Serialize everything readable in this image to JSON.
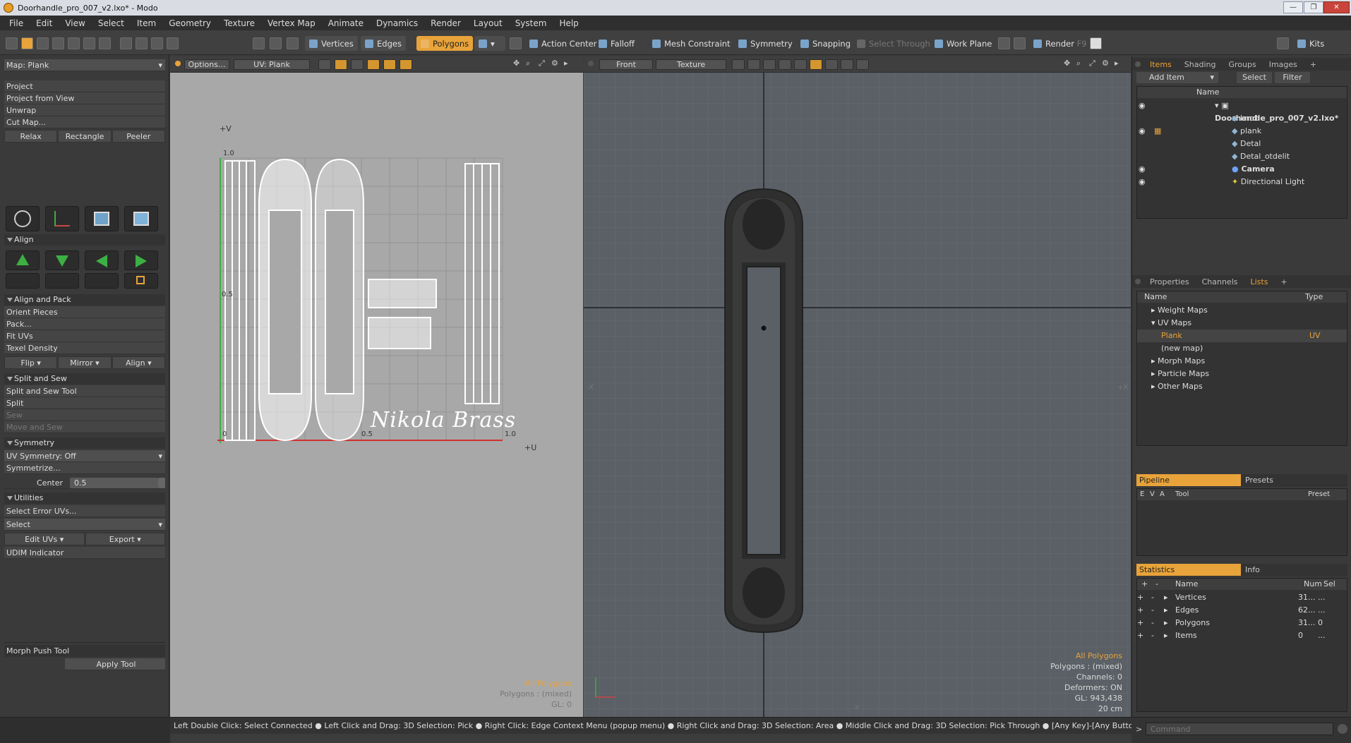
{
  "window": {
    "title": "Doorhandle_pro_007_v2.lxo* - Modo",
    "min": "—",
    "max": "❐",
    "close": "✕"
  },
  "menu": [
    "File",
    "Edit",
    "View",
    "Select",
    "Item",
    "Geometry",
    "Texture",
    "Vertex Map",
    "Animate",
    "Dynamics",
    "Render",
    "Layout",
    "System",
    "Help"
  ],
  "toolbar": {
    "vertices": "Vertices",
    "edges": "Edges",
    "polygons": "Polygons",
    "action_center": "Action Center",
    "falloff": "Falloff",
    "mesh_constraint": "Mesh Constraint",
    "symmetry": "Symmetry",
    "snapping": "Snapping",
    "select_through": "Select Through",
    "work_plane": "Work Plane",
    "render": "Render",
    "render_key": "F9",
    "kits": "Kits"
  },
  "left_panel": {
    "map_select": "Map: Plank",
    "project_items": [
      "Project",
      "Project from View",
      "Unwrap",
      "Cut Map..."
    ],
    "relax_buttons": [
      "Relax",
      "Rectangle",
      "Peeler"
    ],
    "align_head": "Align",
    "align_pack_head": "Align and Pack",
    "align_pack_items": [
      "Orient Pieces",
      "Pack...",
      "Fit UVs",
      "Texel Density"
    ],
    "fmalign": [
      "Flip",
      "Mirror",
      "Align"
    ],
    "split_sew_head": "Split and Sew",
    "split_sew_items": [
      "Split and Sew Tool",
      "Split",
      "Sew",
      "Move and Sew"
    ],
    "symmetry_head": "Symmetry",
    "uv_symmetry": "UV Symmetry: Off",
    "symmetrize": "Symmetrize...",
    "center_label": "Center",
    "center_value": "0.5",
    "utilities_head": "Utilities",
    "select_error": "Select Error UVs...",
    "select": "Select",
    "edit_uvs": "Edit UVs",
    "export": "Export",
    "udim": "UDIM Indicator",
    "morph_push": "Morph Push Tool",
    "apply_tool": "Apply Tool"
  },
  "uv_view": {
    "options": "Options...",
    "uv_label": "UV: Plank",
    "axis_v": "+V",
    "axis_u": "+U",
    "tick_top": "1.0",
    "tick_mid_v": "0.5",
    "tick_origin": "0",
    "tick_mid_u": "0.5",
    "tick_right": "1.0",
    "watermark": "Nikola Brass",
    "info_all": "All Polygons",
    "info_poly": "Polygons : (mixed)",
    "info_gl": "GL: 0"
  },
  "view_3d": {
    "mode": "Front",
    "shading": "Texture",
    "info_all": "All Polygons",
    "info_poly": "Polygons : (mixed)",
    "info_channels": "Channels: 0",
    "info_deformers": "Deformers: ON",
    "info_gl": "GL: 943,438",
    "info_scale": "20 cm",
    "axis_x_left": "-X",
    "axis_x_right": "+X",
    "axis_y": "-Y"
  },
  "items_panel": {
    "tabs": [
      "Items",
      "Shading",
      "Groups",
      "Images"
    ],
    "add_item": "Add Item",
    "select": "Select",
    "filter": "Filter",
    "col_name": "Name",
    "tree": [
      {
        "name": "Doorhandle_pro_007_v2.lxo*",
        "level": 0,
        "bold": true
      },
      {
        "name": "knob",
        "level": 1,
        "bold": false
      },
      {
        "name": "plank",
        "level": 1,
        "bold": false
      },
      {
        "name": "Detal",
        "level": 1,
        "bold": false
      },
      {
        "name": "Detal_otdelit",
        "level": 1,
        "bold": false
      },
      {
        "name": "Camera",
        "level": 1,
        "bold": true
      },
      {
        "name": "Directional Light",
        "level": 1,
        "bold": false
      }
    ]
  },
  "lists_panel": {
    "tabs": [
      "Properties",
      "Channels",
      "Lists"
    ],
    "col_name": "Name",
    "col_type": "Type",
    "rows": [
      {
        "name": "Weight Maps",
        "type": ""
      },
      {
        "name": "UV Maps",
        "type": ""
      },
      {
        "name": "Plank",
        "type": "UV"
      },
      {
        "name": "(new map)",
        "type": ""
      },
      {
        "name": "Morph Maps",
        "type": ""
      },
      {
        "name": "Particle Maps",
        "type": ""
      },
      {
        "name": "Other Maps",
        "type": ""
      }
    ]
  },
  "pipeline_panel": {
    "tabs": [
      "Pipeline",
      "Presets"
    ],
    "cols": [
      "E",
      "V",
      "A",
      "Tool",
      "Preset"
    ]
  },
  "stats_panel": {
    "tabs": [
      "Statistics",
      "Info"
    ],
    "col_name": "Name",
    "col_num": "Num",
    "col_sel": "Sel",
    "rows": [
      {
        "name": "Vertices",
        "num": "31...",
        "sel": "..."
      },
      {
        "name": "Edges",
        "num": "62...",
        "sel": "..."
      },
      {
        "name": "Polygons",
        "num": "31...",
        "sel": "0"
      },
      {
        "name": "Items",
        "num": "0",
        "sel": "..."
      }
    ]
  },
  "command": {
    "placeholder": "Command"
  },
  "status": "Left Double Click: Select Connected ● Left Click and Drag: 3D Selection: Pick ● Right Click: Edge Context Menu (popup menu) ● Right Click and Drag: 3D Selection: Area ● Middle Click and Drag: 3D Selection: Pick Through ● [Any Key]-[Any Button] Click and Drag: dragDropBegin",
  "colors": {
    "accent": "#e8a33a",
    "uv_bg": "#a8a8a8",
    "viewport_bg": "#5a6066"
  }
}
